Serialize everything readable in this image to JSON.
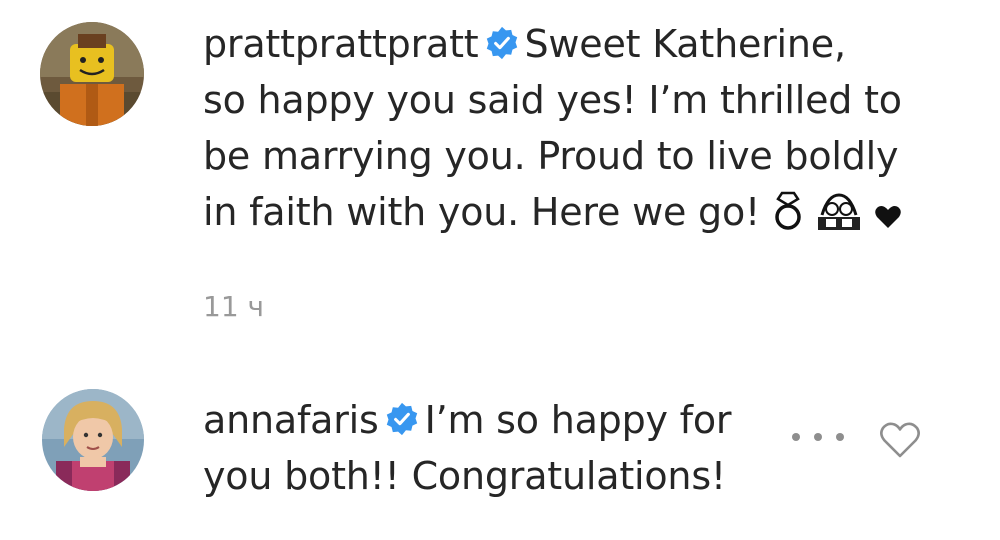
{
  "comments": [
    {
      "username": "prattprattpratt",
      "verified": true,
      "line1": "Sweet Katherine,",
      "line2": "so happy you said yes! I’m thrilled to",
      "line3": "be marrying you. Proud to live boldly",
      "line4": "in faith with you. Here we go!",
      "emojis": [
        "ring-icon",
        "couple-icon",
        "heart-icon"
      ],
      "timestamp": "11 ч"
    },
    {
      "username": "annafaris",
      "verified": true,
      "line1": "I’m so happy for",
      "line2": "you both!! Congratulations!"
    }
  ],
  "colors": {
    "text": "#262626",
    "verified_blue": "#3897f0",
    "muted": "#999999",
    "icon_gray": "#8e8e8e"
  }
}
